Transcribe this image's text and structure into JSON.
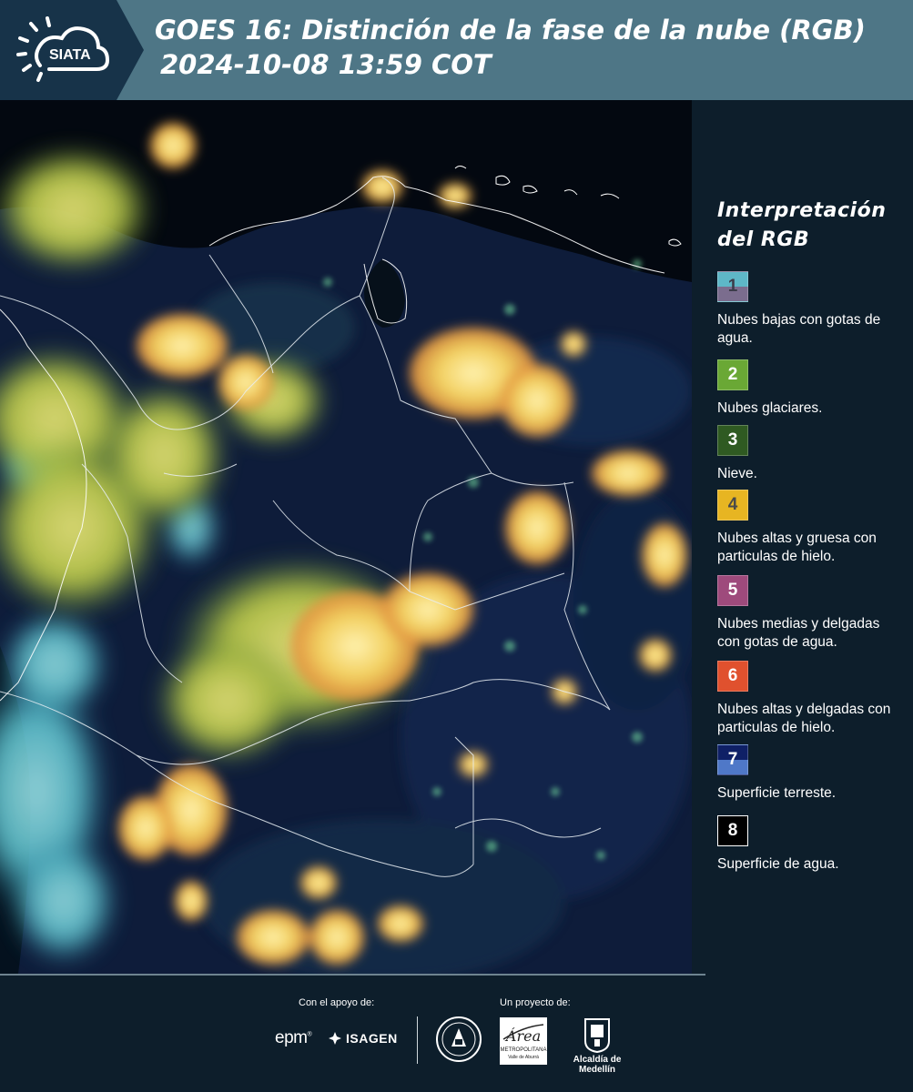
{
  "header": {
    "logo_text": "SIATA",
    "title_line1": "GOES 16: Distinción de la fase de la nube (RGB)",
    "title_line2": "2024-10-08 13:59 COT"
  },
  "legend": {
    "title_line1": "Interpretación",
    "title_line2": "del RGB",
    "items": [
      {
        "num": "1",
        "label": "Nubes bajas con gotas de agua.",
        "color_top": "#5eb7c7",
        "color_bottom": "#7b6d8e",
        "num_color": "#3c3c4a"
      },
      {
        "num": "2",
        "label": "Nubes glaciares.",
        "color_top": "#6aa835",
        "color_bottom": "#6aa835",
        "num_color": "#ffffff"
      },
      {
        "num": "3",
        "label": "Nieve.",
        "color_top": "#2f5a22",
        "color_bottom": "#2f5a22",
        "num_color": "#ffffff"
      },
      {
        "num": "4",
        "label": "Nubes altas y gruesa con particulas de hielo.",
        "color_top": "#e7b522",
        "color_bottom": "#e7b522",
        "num_color": "#4a4a4a"
      },
      {
        "num": "5",
        "label": "Nubes medias y delgadas con gotas de agua.",
        "color_top": "#9e4a7c",
        "color_bottom": "#9e4a7c",
        "num_color": "#ffffff"
      },
      {
        "num": "6",
        "label": "Nubes altas y delgadas con particulas de hielo.",
        "color_top": "#e0512e",
        "color_bottom": "#e0512e",
        "num_color": "#ffffff"
      },
      {
        "num": "7",
        "label": "Superficie terreste.",
        "color_top": "#0f2066",
        "color_bottom": "#4f78c8",
        "num_color": "#ffffff"
      },
      {
        "num": "8",
        "label": "Superficie de agua.",
        "color_top": "#000000",
        "color_bottom": "#000000",
        "num_color": "#ffffff"
      }
    ]
  },
  "footer": {
    "support_label": "Con el apoyo de:",
    "project_label": "Un proyecto de:",
    "epm_text": "epm",
    "isagen_text": "ISAGEN",
    "area_text_1": "Área",
    "area_text_2": "METROPOLITANA",
    "area_text_3": "Valle de Aburrá",
    "alcaldia_text": "Alcaldía de Medellín"
  },
  "colors": {
    "header_bg": "#4e7686",
    "logo_bg": "#173349",
    "page_bg": "#0d1e2b",
    "cloud_high_thick": "#f2d36a",
    "cloud_low_water": "#5ecbd6",
    "land_surface": "#10264a",
    "water_surface": "#000000"
  }
}
